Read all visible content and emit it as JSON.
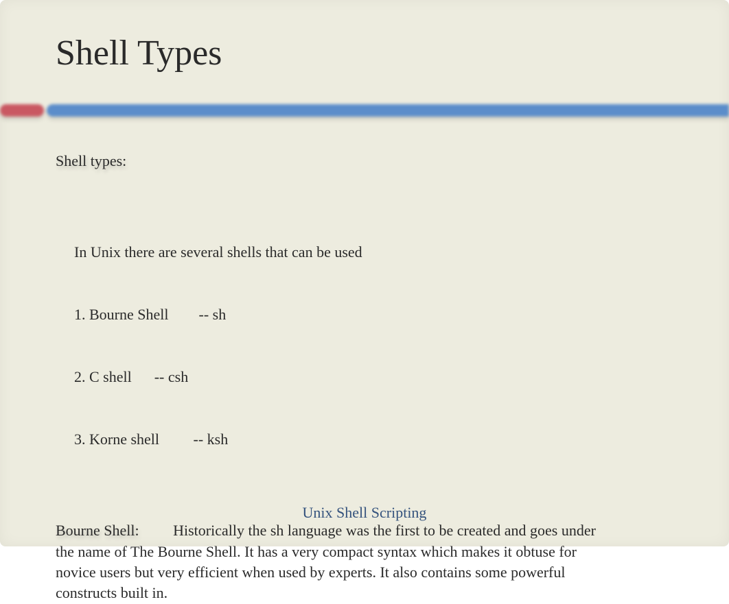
{
  "title": "Shell Types",
  "section_label": "Shell types:",
  "intro_line": "In Unix there are several shells that can be used",
  "shells": [
    "1. Bourne Shell        -- sh",
    "2. C shell      -- csh",
    "3. Korne shell         -- ksh"
  ],
  "bourne_label": "Bourne Shell:",
  "bourne_text": "Historically the sh language was the first to be created and goes under the name of The Bourne Shell. It has a very compact syntax which makes it obtuse for novice users but very efficient when used by experts. It also contains some powerful constructs built in.",
  "footer": "Unix Shell Scripting",
  "colors": {
    "background": "#edecdf",
    "accent_red": "#c95862",
    "accent_blue": "#5B8DCA",
    "footer_text": "#35537d"
  }
}
